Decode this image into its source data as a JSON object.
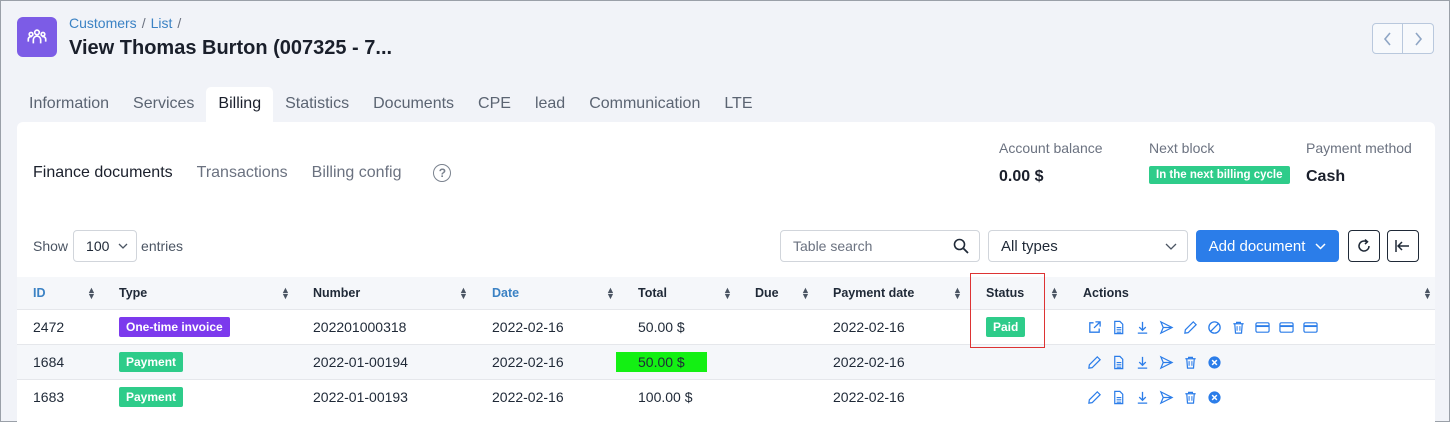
{
  "breadcrumb": {
    "first": "Customers",
    "second": "List",
    "sep": "/"
  },
  "page_title": "View Thomas Burton (007325 - 7...",
  "tabs": [
    "Information",
    "Services",
    "Billing",
    "Statistics",
    "Documents",
    "CPE",
    "lead",
    "Communication",
    "LTE"
  ],
  "active_tab": "Billing",
  "subtabs": {
    "finance": "Finance documents",
    "transactions": "Transactions",
    "config": "Billing config",
    "help": "?"
  },
  "summary": {
    "balance_label": "Account balance",
    "balance_value": "0.00 $",
    "block_label": "Next block",
    "block_value": "In the next billing cycle",
    "payment_label": "Payment method",
    "payment_value": "Cash"
  },
  "controls": {
    "show": "Show",
    "entries_value": "100",
    "entries": "entries",
    "search_placeholder": "Table search",
    "types_value": "All types",
    "add_document": "Add document"
  },
  "table": {
    "headers": [
      "ID",
      "Type",
      "Number",
      "Date",
      "Total",
      "Due",
      "Payment date",
      "Status",
      "Actions"
    ],
    "rows": [
      {
        "id": "2472",
        "type": "One-time invoice",
        "number": "202201000318",
        "date": "2022-02-16",
        "total": "50.00 $",
        "due": "",
        "payment_date": "2022-02-16",
        "status": "Paid"
      },
      {
        "id": "1684",
        "type": "Payment",
        "number": "2022-01-00194",
        "date": "2022-02-16",
        "total": "50.00 $",
        "due": "",
        "payment_date": "2022-02-16",
        "status": ""
      },
      {
        "id": "1683",
        "type": "Payment",
        "number": "2022-01-00193",
        "date": "2022-02-16",
        "total": "100.00 $",
        "due": "",
        "payment_date": "2022-02-16",
        "status": ""
      }
    ]
  },
  "colors": {
    "accent": "#2b7de9",
    "purple": "#7c5ce6",
    "green": "#2ecc8a",
    "highlight": "#13f013",
    "link": "#3b82c4",
    "icon_blue": "#2b7de9"
  },
  "icons": {
    "row1_actions": [
      "external-link-icon",
      "document-icon",
      "download-icon",
      "send-icon",
      "edit-icon",
      "cancel-icon",
      "delete-icon",
      "card-icon",
      "card-icon",
      "card-icon"
    ],
    "row_payment_actions": [
      "edit-icon",
      "document-icon",
      "download-icon",
      "send-icon",
      "delete-icon",
      "remove-icon"
    ]
  }
}
